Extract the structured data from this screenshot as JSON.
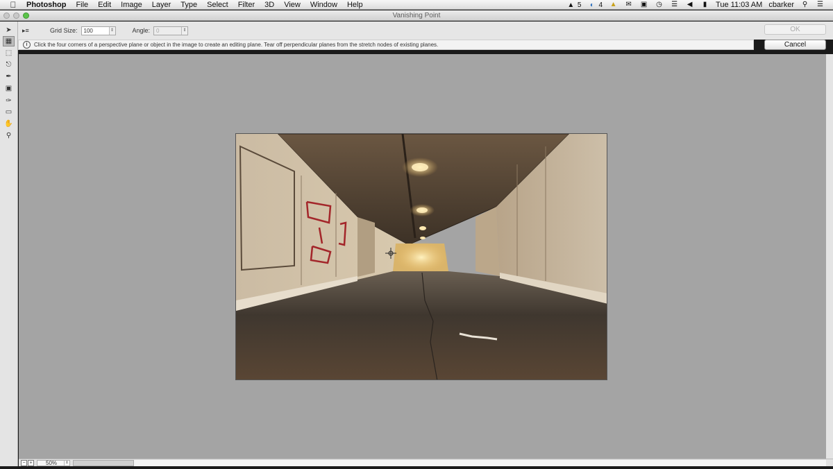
{
  "menubar": {
    "app": "Photoshop",
    "items": [
      "File",
      "Edit",
      "Image",
      "Layer",
      "Type",
      "Select",
      "Filter",
      "3D",
      "View",
      "Window",
      "Help"
    ],
    "status": {
      "adobe_count": "5",
      "cc_count": "4",
      "datetime": "Tue 11:03 AM",
      "user": "cbarker"
    },
    "icons": [
      "adobe-icon",
      "creative-cloud-icon",
      "warning-icon",
      "mail-icon",
      "display-icon",
      "time-machine-icon",
      "wifi-icon",
      "volume-icon",
      "battery-icon",
      "spotlight-icon",
      "notification-list-icon"
    ]
  },
  "window": {
    "title": "Vanishing Point"
  },
  "options": {
    "grid_size_label": "Grid Size:",
    "grid_size_value": "100",
    "angle_label": "Angle:",
    "angle_value": "0"
  },
  "buttons": {
    "ok": "OK",
    "cancel": "Cancel"
  },
  "info": {
    "message": "Click the four corners of a perspective plane or object in the image to create an editing plane. Tear off perpendicular planes from the stretch nodes of existing planes."
  },
  "tools": [
    {
      "name": "edit-plane-tool",
      "icon": "arrow-icon",
      "active": false
    },
    {
      "name": "create-plane-tool",
      "icon": "create-plane-icon",
      "active": true
    },
    {
      "name": "marquee-tool",
      "icon": "marquee-icon",
      "active": false
    },
    {
      "name": "stamp-tool",
      "icon": "stamp-icon",
      "active": false
    },
    {
      "name": "brush-tool",
      "icon": "brush-icon",
      "active": false
    },
    {
      "name": "transform-tool",
      "icon": "transform-icon",
      "active": false
    },
    {
      "name": "eyedropper-tool",
      "icon": "eyedropper-icon",
      "active": false
    },
    {
      "name": "measure-tool",
      "icon": "measure-icon",
      "active": false
    },
    {
      "name": "hand-tool",
      "icon": "hand-icon",
      "active": false
    },
    {
      "name": "zoom-tool",
      "icon": "zoom-icon",
      "active": false
    }
  ],
  "status": {
    "zoom": "50%"
  },
  "colors": {
    "canvas": "#a4a4a4",
    "panel": "#e6e6e6",
    "graffiti": "#a3262a"
  }
}
